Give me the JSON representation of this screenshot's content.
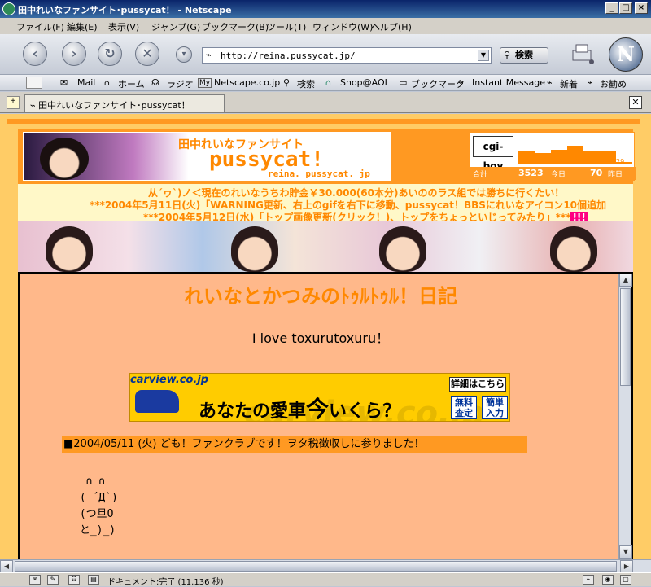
{
  "window": {
    "title": "田中れいなファンサイト･pussycat！ - Netscape",
    "buttons": {
      "minimize": "_",
      "maximize": "□",
      "close": "×"
    }
  },
  "menu": [
    "ファイル(F)",
    "編集(E)",
    "表示(V)",
    "ジャンプ(G)",
    "ブックマーク(B)",
    "ツール(T)",
    "ウィンドウ(W)",
    "ヘルプ(H)"
  ],
  "nav": {
    "back_icon": "back-arrow-icon",
    "forward_icon": "forward-arrow-icon",
    "reload_icon": "reload-icon",
    "stop_icon": "stop-icon",
    "url": "http://reina.pussycat.jp/",
    "search_label": "検索",
    "logo_letter": "N"
  },
  "personal_toolbar": [
    "Mail",
    "ホーム",
    "ラジオ",
    "Netscape.co.jp",
    "検索",
    "Shop@AOL",
    "ブックマーク",
    "Instant Message",
    "新着",
    "お勧め"
  ],
  "tab": {
    "label": "田中れいなファンサイト･pussycat！"
  },
  "page": {
    "banner": {
      "line1": "田中れいなファンサイト",
      "line2": "pussycat!",
      "line3": "reina. pussycat. jp"
    },
    "counter": {
      "logo": "cgi-boy",
      "bars": [
        259,
        231,
        299,
        389,
        258,
        272,
        29
      ],
      "total_label": "合計",
      "total_value": "3523",
      "today_label": "今日",
      "today_value": "70",
      "yesterday_label": "昨日"
    },
    "news": [
      "从´ヮ`)ノ＜現在のれいなうちわ貯金￥30.000(60本分)あいののラス組では勝ちに行くたい！",
      "***2004年5月11日(火)「WARNING更新、右上のgifを右下に移動、pussycat！BBSにれいなアイコン10個追加",
      "***2004年5月12日(水)「トップ画像更新(クリック！)、トップをちょっといじってみたり」***"
    ],
    "new_tag": "!!!",
    "diary_title": "れいなとかつみのﾄｩﾙﾄｩﾙ！日記",
    "love": "I love toxurutoxuru！",
    "ad": {
      "brand": "carview.co.jp",
      "headline_pre": "あなたの愛車",
      "headline_big": "今",
      "headline_post": "いくら？",
      "watermark": "carview.co.jp",
      "detail": "詳細はこちら",
      "btn1": "無料査定",
      "btn2": "簡単入力"
    },
    "entry_head": "■2004/05/11 (火) ども！ファンクラブです！ヲタ税徴収しに参りました！",
    "ascii_art": "  ∩ ∩\n ( ´Д`)\n (つ旦O\n と_)_)"
  },
  "status": {
    "text": "ドキュメント:完了 (11.136 秒)"
  }
}
